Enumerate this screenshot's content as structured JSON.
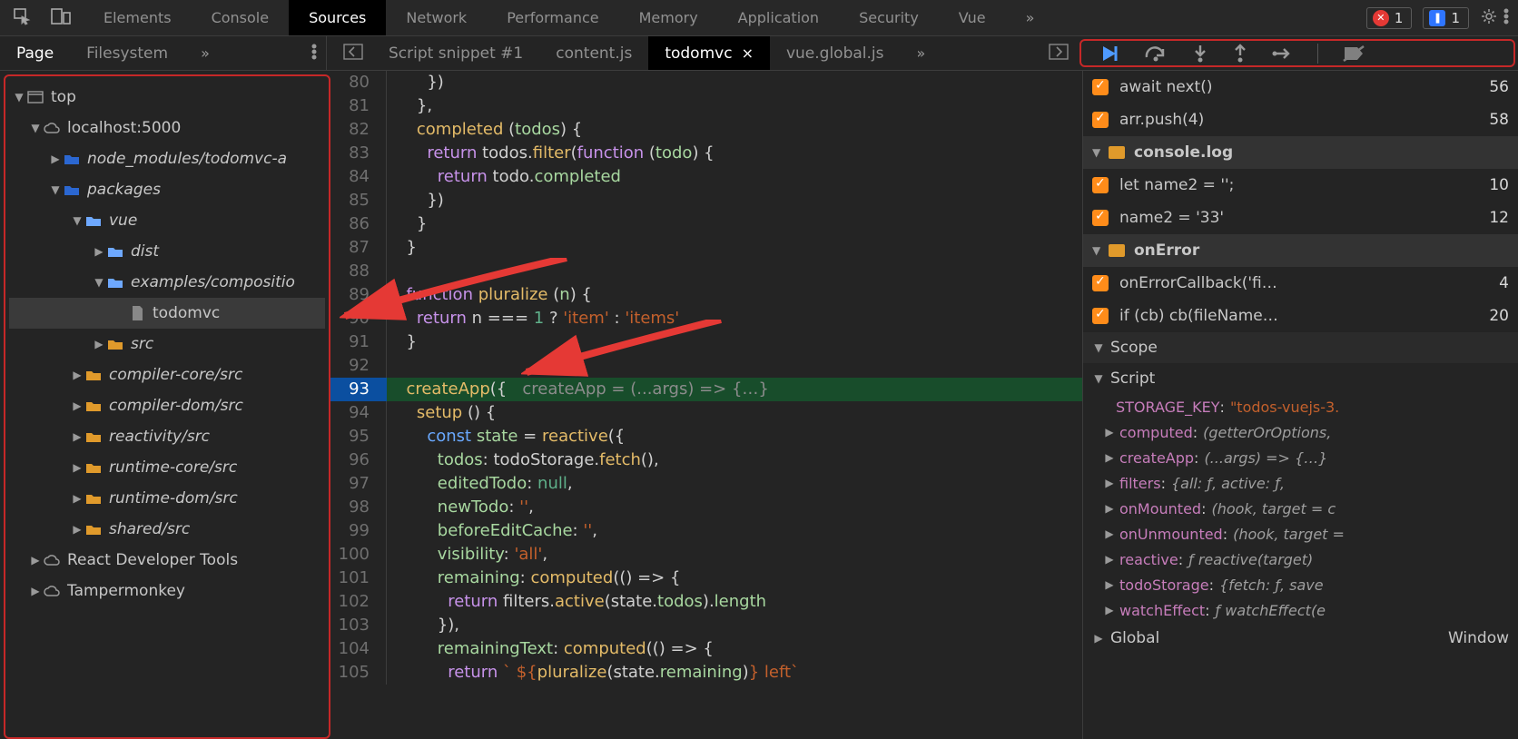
{
  "mainTabs": {
    "items": [
      {
        "label": "Elements"
      },
      {
        "label": "Console"
      },
      {
        "label": "Sources"
      },
      {
        "label": "Network"
      },
      {
        "label": "Performance"
      },
      {
        "label": "Memory"
      },
      {
        "label": "Application"
      },
      {
        "label": "Security"
      },
      {
        "label": "Vue"
      }
    ],
    "activeIndex": 2,
    "errorBadge": "1",
    "infoBadge": "1"
  },
  "navPane": {
    "tabs": [
      {
        "label": "Page"
      },
      {
        "label": "Filesystem"
      }
    ],
    "activeIndex": 0
  },
  "fileTabs": {
    "items": [
      {
        "label": "Script snippet #1"
      },
      {
        "label": "content.js"
      },
      {
        "label": "todomvc"
      },
      {
        "label": "vue.global.js"
      }
    ],
    "activeIndex": 2
  },
  "tree": {
    "top": "top",
    "localhost": "localhost:5000",
    "nodeModules": "node_modules/todomvc-a",
    "packages": "packages",
    "vue": "vue",
    "dist": "dist",
    "examples": "examples/compositio",
    "todomvc": "todomvc",
    "src": "src",
    "compilerCore": "compiler-core/src",
    "compilerDom": "compiler-dom/src",
    "reactivity": "reactivity/src",
    "runtimeCore": "runtime-core/src",
    "runtimeDom": "runtime-dom/src",
    "shared": "shared/src",
    "reactTools": "React Developer Tools",
    "tamper": "Tampermonkey"
  },
  "editor": {
    "lines": [
      {
        "no": 80,
        "raw": "      })"
      },
      {
        "no": 81,
        "raw": "    },"
      },
      {
        "no": 82,
        "completedDecl": true
      },
      {
        "no": 83,
        "returnFilter": true
      },
      {
        "no": 84,
        "returnCompleted": true
      },
      {
        "no": 85,
        "raw": "      })"
      },
      {
        "no": 86,
        "raw": "    }"
      },
      {
        "no": 87,
        "raw": "  }"
      },
      {
        "no": 88,
        "raw": ""
      },
      {
        "no": 89,
        "pluralizeDecl": true
      },
      {
        "no": 90,
        "pluralizeRet": true
      },
      {
        "no": 91,
        "raw": "  }"
      },
      {
        "no": 92,
        "raw": ""
      },
      {
        "no": 93,
        "hl": true,
        "createApp": true,
        "inlay": "createApp = (...args) => {…}"
      },
      {
        "no": 94,
        "setup": true
      },
      {
        "no": 95,
        "stateReactive": true
      },
      {
        "no": 96,
        "todosFetch": true
      },
      {
        "no": 97,
        "editedTodo": true
      },
      {
        "no": 98,
        "newTodo": true
      },
      {
        "no": 99,
        "beforeEdit": true
      },
      {
        "no": 100,
        "visibility": true
      },
      {
        "no": 101,
        "remaining": true
      },
      {
        "no": 102,
        "remainingRet": true
      },
      {
        "no": 103,
        "raw": "        }),"
      },
      {
        "no": 104,
        "remainingText": true
      },
      {
        "no": 105,
        "remainingTextRet": true
      }
    ]
  },
  "breakpointGroups": [
    {
      "items": [
        {
          "text": "await next()",
          "line": 56
        },
        {
          "text": "arr.push(4)",
          "line": 58
        }
      ]
    },
    {
      "label": "console.log",
      "items": [
        {
          "text": "let name2 = '';",
          "line": 10
        },
        {
          "text": "name2 = '33'",
          "line": 12
        }
      ]
    },
    {
      "label": "onError",
      "items": [
        {
          "text": "onErrorCallback('fi…",
          "line": 4
        },
        {
          "text": "if (cb) cb(fileName…",
          "line": 20
        }
      ]
    }
  ],
  "scope": {
    "header": "Scope",
    "scriptLabel": "Script",
    "entries": [
      {
        "key": "STORAGE_KEY",
        "val": "\"todos-vuejs-3.",
        "cls": "str"
      },
      {
        "key": "computed",
        "val": "(getterOrOptions,",
        "cls": "ital",
        "tri": true
      },
      {
        "key": "createApp",
        "val": "(...args) => {…}",
        "cls": "ital",
        "tri": true
      },
      {
        "key": "filters",
        "val": "{all: ƒ, active: ƒ,",
        "cls": "ital",
        "tri": true
      },
      {
        "key": "onMounted",
        "val": "(hook, target = c",
        "cls": "ital",
        "tri": true
      },
      {
        "key": "onUnmounted",
        "val": "(hook, target =",
        "cls": "ital",
        "tri": true
      },
      {
        "key": "reactive",
        "val": "ƒ reactive(target)",
        "cls": "ital",
        "tri": true
      },
      {
        "key": "todoStorage",
        "val": "{fetch: ƒ, save",
        "cls": "ital",
        "tri": true
      },
      {
        "key": "watchEffect",
        "val": "ƒ watchEffect(e",
        "cls": "ital",
        "tri": true
      }
    ],
    "globalLabel": "Global",
    "globalVal": "Window"
  }
}
